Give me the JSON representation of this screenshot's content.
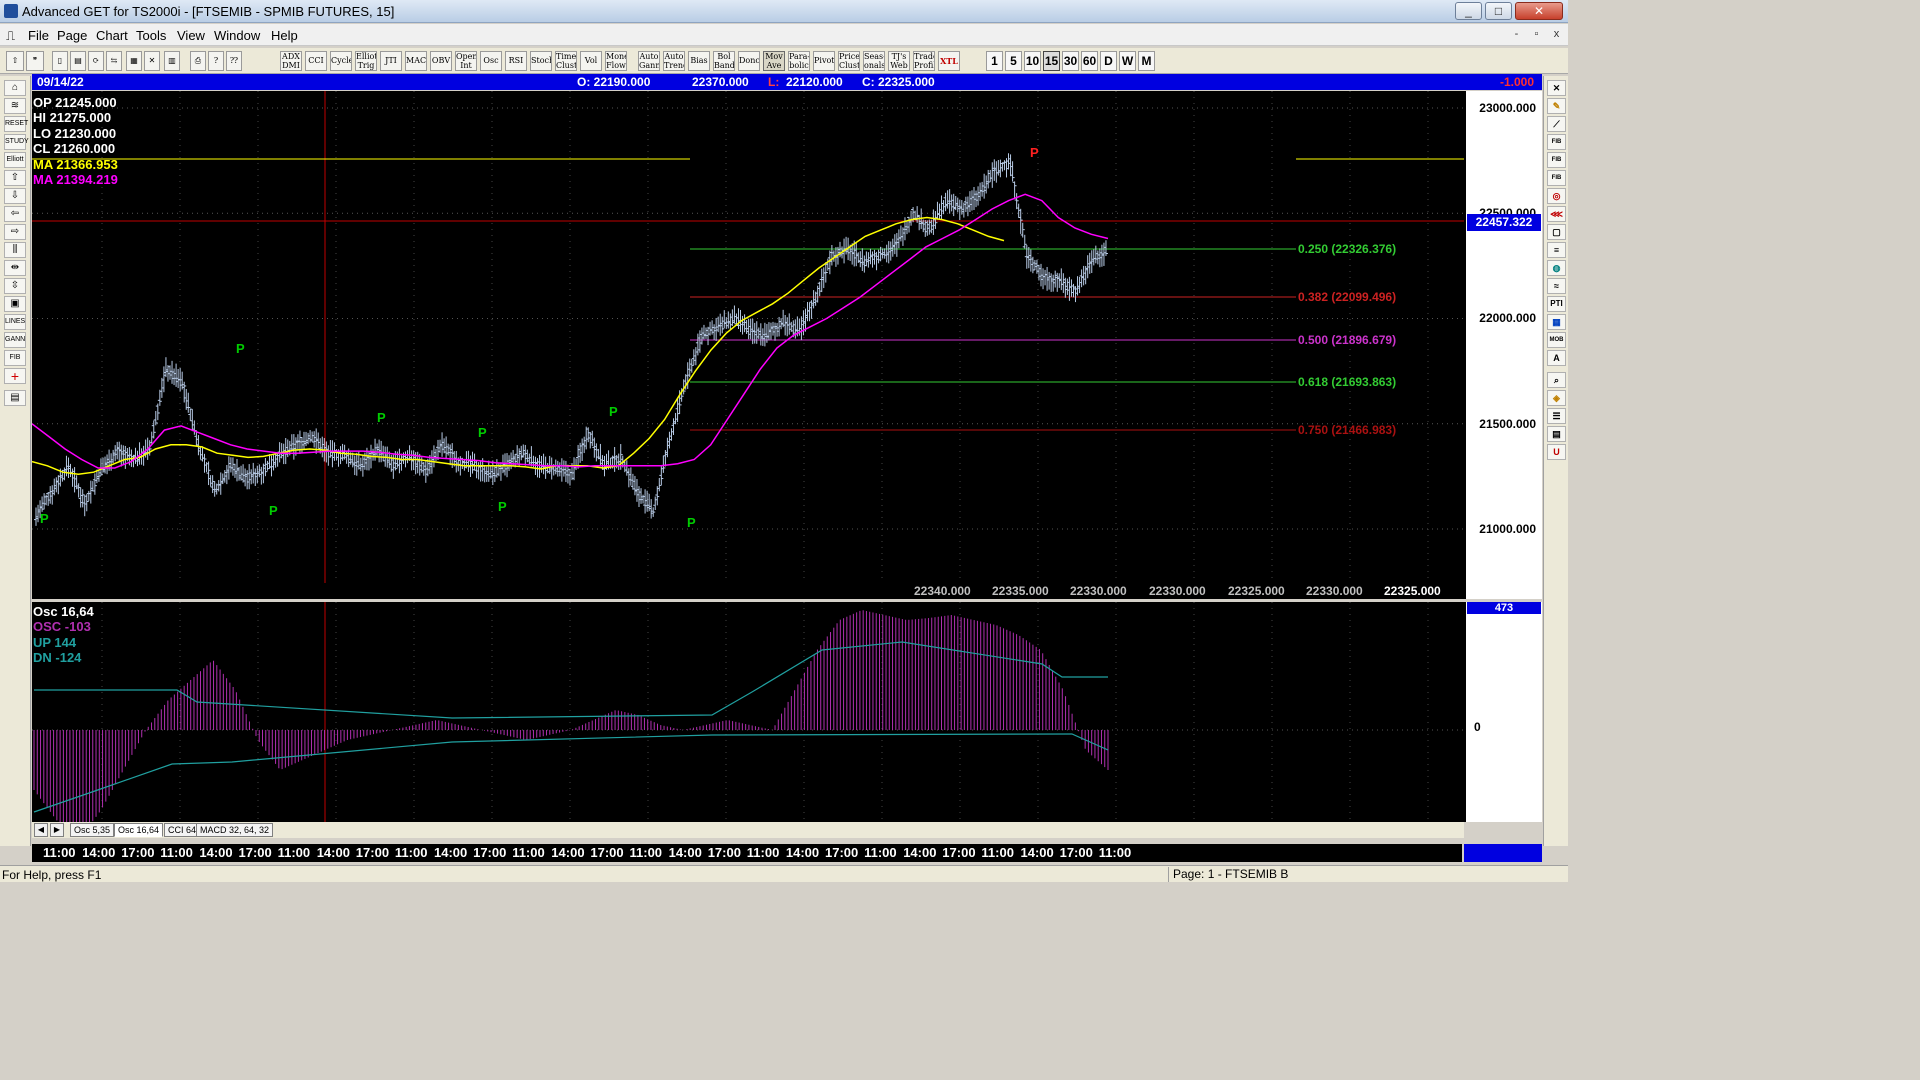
{
  "window": {
    "title": "Advanced GET for TS2000i - [FTSEMIB - SPMIB FUTURES, 15]",
    "controls": {
      "minimize": "_",
      "maximize": "□",
      "close": "✕"
    }
  },
  "menu": {
    "items": [
      "File",
      "Page",
      "Chart",
      "Tools",
      "View",
      "Window",
      "Help"
    ],
    "mdi_controls": [
      "-",
      "▫",
      "x"
    ]
  },
  "toolbar": {
    "study_buttons": [
      [
        "ADX",
        "DMI"
      ],
      [
        "CCI"
      ],
      [
        "Cycles"
      ],
      [
        "Elliott",
        "Trig"
      ],
      [
        "JTI"
      ],
      [
        "MACD"
      ],
      [
        "OBV"
      ],
      [
        "Open",
        "Int"
      ],
      [
        "Osc"
      ],
      [
        "RSI"
      ],
      [
        "Stoch"
      ],
      [
        "Time",
        "Clust"
      ],
      [
        "Vol"
      ],
      [
        "Money",
        "Flow"
      ],
      [
        "Auto",
        "Gann"
      ],
      [
        "Auto",
        "Trend"
      ],
      [
        "Bias"
      ],
      [
        "Bol",
        "Band"
      ],
      [
        "Donch"
      ],
      [
        "Mov",
        "Ave"
      ],
      [
        "Para-",
        "bolic"
      ],
      [
        "Pivot"
      ],
      [
        "Price",
        "Clust"
      ],
      [
        "Seas-",
        "onals"
      ],
      [
        "TJ's",
        "Web"
      ],
      [
        "Trade",
        "Profile"
      ],
      [
        "XTL"
      ]
    ],
    "timeframes": [
      "1",
      "5",
      "10",
      "15",
      "30",
      "60",
      "D",
      "W",
      "M"
    ],
    "active_timeframe": "15"
  },
  "header": {
    "date": "09/14/22",
    "open": "O: 22190.000",
    "high": "22370.000",
    "low_label": "L:",
    "low": "22120.000",
    "close": "C: 22325.000",
    "change": "-1.000"
  },
  "ohlc": {
    "op": "OP  21245.000",
    "hi": "HI   21275.000",
    "lo": "LO   21230.000",
    "cl": "CL   21260.000",
    "ma1": "MA  21366.953",
    "ma2": "MA  21394.219"
  },
  "price_scale": {
    "labels": [
      "23000.000",
      "22500.000",
      "22000.000",
      "21500.000",
      "21000.000"
    ],
    "current": "22457.322"
  },
  "fib": {
    "levels": [
      {
        "label": "0.250 (22326.376)",
        "color": "#33cc33"
      },
      {
        "label": "0.382 (22099.496)",
        "color": "#cc2222"
      },
      {
        "label": "0.500 (21896.679)",
        "color": "#cc33cc"
      },
      {
        "label": "0.618 (21693.863)",
        "color": "#33cc33"
      },
      {
        "label": "0.750 (21466.983)",
        "color": "#aa1111"
      }
    ]
  },
  "tick_values": [
    "22340.000",
    "22335.000",
    "22330.000",
    "22330.000",
    "22325.000",
    "22330.000",
    "22325.000"
  ],
  "oscillator": {
    "title": "Osc 16,64",
    "osc": "OSC -103",
    "up": "UP   144",
    "dn": "DN   -124",
    "scale_top": "473",
    "zero": "0"
  },
  "osc_tabs": [
    "Osc 5,35",
    "Osc 16,64",
    "CCI 64",
    "MACD 32, 64, 32"
  ],
  "active_osc_tab": "Osc 16,64",
  "time_axis": [
    "11:00",
    "14:00",
    "17:00",
    "11:00",
    "14:00",
    "17:00",
    "11:00",
    "14:00",
    "17:00",
    "11:00",
    "14:00",
    "17:00",
    "11:00",
    "14:00",
    "17:00",
    "11:00",
    "14:00",
    "17:00",
    "11:00",
    "14:00",
    "17:00",
    "11:00",
    "14:00",
    "17:00",
    "11:00",
    "14:00",
    "17:00",
    "11:00"
  ],
  "status": {
    "help": "For Help, press F1",
    "page": "Page: 1 - FTSEMIB B"
  },
  "pivot_marker": "P",
  "colors": {
    "header_blue": "#0000e0",
    "ma_yellow": "#ffff00",
    "ma_magenta": "#ff00ff",
    "bars": "#b8cbe6",
    "pivot_green": "#00cc00",
    "pivot_red": "#ff2020",
    "osc_hist": "#b030b0",
    "osc_line": "#20a0a0"
  },
  "chart_data": {
    "type": "line",
    "title": "FTSEMIB - SPMIB FUTURES, 15",
    "ylim": [
      20600,
      23200
    ],
    "series": [
      {
        "name": "Price",
        "values": [
          21060,
          21180,
          21300,
          21120,
          21280,
          21370,
          21330,
          21380,
          21760,
          21700,
          21400,
          21180,
          21300,
          21240,
          21280,
          21350,
          21400,
          21440,
          21360,
          21350,
          21300,
          21380,
          21300,
          21350,
          21280,
          21400,
          21320,
          21300,
          21260,
          21300,
          21360,
          21300,
          21280,
          21260,
          21460,
          21300,
          21340,
          21180,
          21080,
          21420,
          21700,
          21920,
          21960,
          22000,
          21940,
          21920,
          21980,
          21940,
          22100,
          22300,
          22330,
          22270,
          22300,
          22350,
          22500,
          22420,
          22560,
          22520,
          22580,
          22700,
          22740,
          22300,
          22200,
          22180,
          22130,
          22280,
          22325
        ]
      },
      {
        "name": "MA",
        "values": [
          21320,
          21300,
          21270,
          21260,
          21270,
          21300,
          21330,
          21340,
          21380,
          21400,
          21400,
          21390,
          21360,
          21350,
          21340,
          21345,
          21360,
          21375,
          21380,
          21375,
          21360,
          21355,
          21345,
          21340,
          21330,
          21330,
          21320,
          21310,
          21300,
          21300,
          21300,
          21300,
          21295,
          21285,
          21300,
          21300,
          21300,
          21290,
          21300,
          21360,
          21430,
          21520,
          21640,
          21750,
          21850,
          21930,
          21990,
          22030,
          22070,
          22120,
          22180,
          22240,
          22290,
          22340,
          22390,
          22420,
          22450,
          22470,
          22480,
          22470,
          22450,
          22420,
          22390,
          22370
        ]
      },
      {
        "name": "MA",
        "values": [
          21500,
          21440,
          21380,
          21330,
          21290,
          21290,
          21320,
          21380,
          21470,
          21490,
          21460,
          21430,
          21400,
          21380,
          21370,
          21360,
          21360,
          21365,
          21370,
          21370,
          21370,
          21365,
          21355,
          21350,
          21340,
          21335,
          21330,
          21325,
          21315,
          21310,
          21305,
          21300,
          21300,
          21295,
          21300,
          21300,
          21300,
          21300,
          21300,
          21310,
          21330,
          21400,
          21520,
          21640,
          21760,
          21860,
          21920,
          21960,
          22000,
          22050,
          22100,
          22160,
          22220,
          22280,
          22340,
          22380,
          22420,
          22470,
          22520,
          22560,
          22590,
          22560,
          22480,
          22430,
          22400,
          22380
        ]
      }
    ]
  }
}
